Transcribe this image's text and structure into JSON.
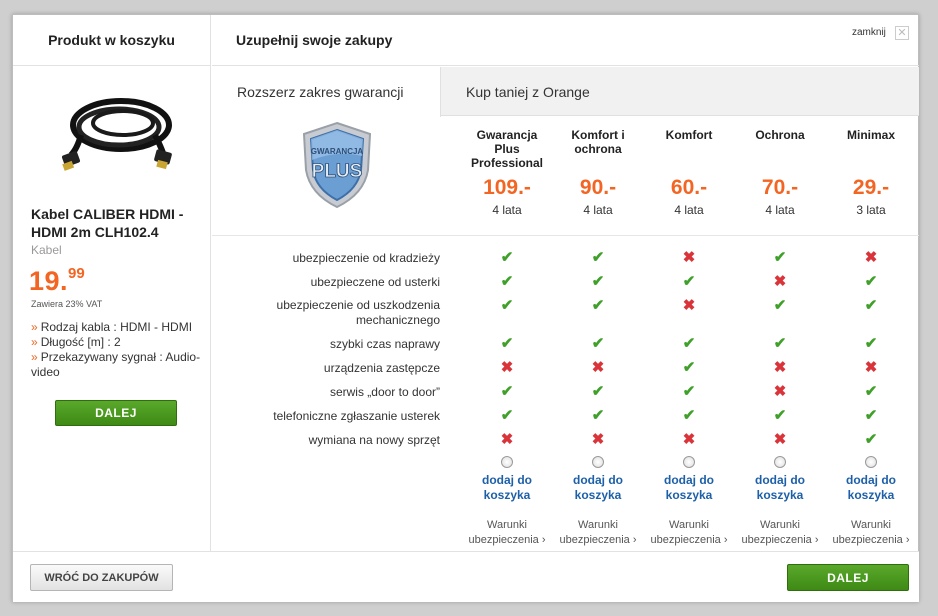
{
  "left": {
    "title": "Produkt w koszyku",
    "product_name": "Kabel CALIBER HDMI - HDMI 2m CLH102.4",
    "category": "Kabel",
    "price_int": "19.",
    "price_dec": "99",
    "vat": "Zawiera 23% VAT",
    "specs": [
      "Rodzaj kabla : HDMI - HDMI",
      "Długość [m] : 2",
      "Przekazywany sygnał : Audio-video"
    ],
    "button": "DALEJ"
  },
  "header": {
    "title": "Uzupełnij swoje zakupy",
    "close_label": "zamknij"
  },
  "tabs": [
    "Rozszerz zakres gwarancji",
    "Kup taniej z Orange"
  ],
  "shield": {
    "line1": "GWARANCJA",
    "line2": "PLUS"
  },
  "plans": [
    {
      "name": "Gwarancja Plus Professional",
      "price": "109.-",
      "years": "4 lata"
    },
    {
      "name": "Komfort i ochrona",
      "price": "90.-",
      "years": "4 lata"
    },
    {
      "name": "Komfort",
      "price": "60.-",
      "years": "4 lata"
    },
    {
      "name": "Ochrona",
      "price": "70.-",
      "years": "4 lata"
    },
    {
      "name": "Minimax",
      "price": "29.-",
      "years": "3 lata"
    }
  ],
  "features": [
    {
      "label": "ubezpieczenie od kradzieży",
      "values": [
        true,
        true,
        false,
        true,
        false
      ]
    },
    {
      "label": "ubezpieczene od usterki",
      "values": [
        true,
        true,
        true,
        false,
        true
      ]
    },
    {
      "label": "ubezpieczenie od uszkodzenia mechanicznego",
      "values": [
        true,
        true,
        false,
        true,
        true
      ]
    },
    {
      "label": "szybki czas naprawy",
      "values": [
        true,
        true,
        true,
        true,
        true
      ]
    },
    {
      "label": "urządzenia zastępcze",
      "values": [
        false,
        false,
        true,
        false,
        false
      ]
    },
    {
      "label": "serwis „door to door”",
      "values": [
        true,
        true,
        true,
        false,
        true
      ]
    },
    {
      "label": "telefoniczne zgłaszanie usterek",
      "values": [
        true,
        true,
        true,
        true,
        true
      ]
    },
    {
      "label": "wymiana na nowy sprzęt",
      "values": [
        false,
        false,
        false,
        false,
        true
      ]
    }
  ],
  "add_to_cart": "dodaj do koszyka",
  "terms": "Warunki ubezpieczenia ›",
  "footer": {
    "back": "WRÓĆ DO ZAKUPÓW",
    "next": "DALEJ"
  },
  "colors": {
    "accent": "#f26522",
    "green_button": "#4a9a1f",
    "check": "#3fa02a",
    "cross": "#d9343a",
    "link": "#1d5fa8"
  }
}
